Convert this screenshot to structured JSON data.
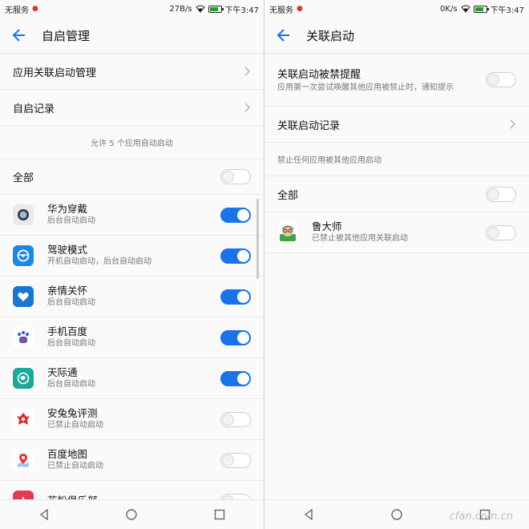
{
  "left": {
    "status": {
      "carrier": "无服务",
      "speed": "27B/s",
      "time": "下午3:47"
    },
    "title": "自启管理",
    "menu": [
      {
        "label": "应用关联启动管理"
      },
      {
        "label": "自启记录"
      }
    ],
    "note": "允许 5 个应用自动启动",
    "all_label": "全部",
    "apps": [
      {
        "name": "华为穿戴",
        "sub": "后台自动启动",
        "on": true,
        "icon": "watch-icon",
        "color": "#3a3f47"
      },
      {
        "name": "驾驶模式",
        "sub": "开机自动启动，后台自动启动",
        "on": true,
        "icon": "steering-wheel-icon",
        "color": "#1e88e5"
      },
      {
        "name": "亲情关怀",
        "sub": "后台自动启动",
        "on": true,
        "icon": "heart-hands-icon",
        "color": "#1976d2"
      },
      {
        "name": "手机百度",
        "sub": "后台自动启动",
        "on": true,
        "icon": "baidu-paw-icon",
        "color": "#2f5bd3"
      },
      {
        "name": "天际通",
        "sub": "后台自动启动",
        "on": true,
        "icon": "globe-icon",
        "color": "#19a89a"
      },
      {
        "name": "安兔兔评测",
        "sub": "已禁止自动启动",
        "on": false,
        "icon": "antutu-icon",
        "color": "#d32f2f"
      },
      {
        "name": "百度地图",
        "sub": "已禁止自动启动",
        "on": false,
        "icon": "map-pin-icon",
        "color": "#e53935"
      },
      {
        "name": "花粉俱乐部",
        "sub": "",
        "on": false,
        "icon": "huafen-icon",
        "color": "#e53950"
      }
    ]
  },
  "right": {
    "status": {
      "carrier": "无服务",
      "speed": "0K/s",
      "time": "下午3:47"
    },
    "title": "关联启动",
    "reminder": {
      "title": "关联启动被禁提醒",
      "desc": "应用第一次尝试唤醒其他应用被禁止时，通知提示"
    },
    "record_label": "关联启动记录",
    "note": "禁止任何应用被其他应用启动",
    "all_label": "全部",
    "app": {
      "name": "鲁大师",
      "sub": "已禁止被其他应用关联启动"
    },
    "watermark": "cfan.com.cn"
  },
  "colors": {
    "accent": "#1a73e8"
  }
}
